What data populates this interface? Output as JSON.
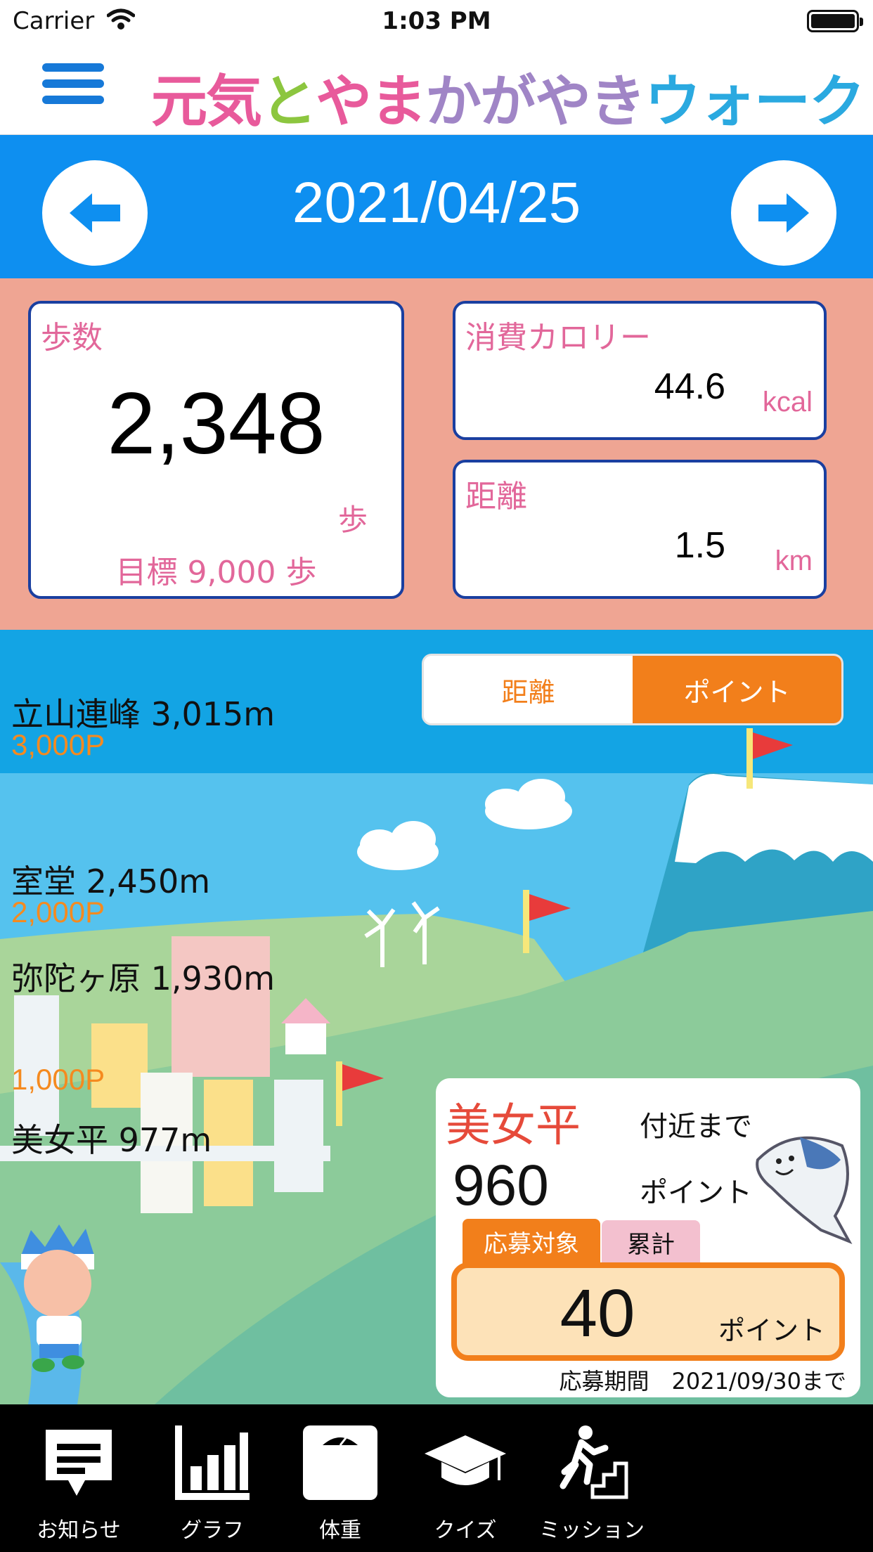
{
  "status_bar": {
    "carrier": "Carrier",
    "time": "1:03 PM"
  },
  "header": {
    "title_parts": [
      "元気",
      "と",
      "やま",
      "かがやき",
      "ウォーク"
    ],
    "colors": {
      "pink": "#e85a9b",
      "green": "#8cc63f",
      "purple": "#a085c6",
      "blue": "#2aa9e0"
    }
  },
  "date_nav": {
    "date": "2021/04/25",
    "prev_icon": "arrow-left-icon",
    "next_icon": "arrow-right-icon"
  },
  "stats": {
    "steps": {
      "label": "歩数",
      "value": "2,348",
      "unit": "歩",
      "goal": "目標 9,000 歩"
    },
    "calories": {
      "label": "消費カロリー",
      "value": "44.6",
      "unit": "kcal"
    },
    "distance": {
      "label": "距離",
      "value": "1.5",
      "unit": "km"
    }
  },
  "map": {
    "toggle": {
      "distance": "距離",
      "point": "ポイント",
      "selected": "ポイント"
    },
    "landmarks": [
      {
        "name": "立山連峰 3,015m",
        "points": "3,000P"
      },
      {
        "name": "室堂 2,450m",
        "points": "2,000P"
      },
      {
        "name": "弥陀ヶ原 1,930m",
        "points": ""
      },
      {
        "name": "美女平 977m",
        "points": "1,000P"
      }
    ]
  },
  "points_card": {
    "place": "美女平",
    "until": "付近まで",
    "remaining": "960",
    "remaining_unit": "ポイント",
    "tabs": {
      "apply": "応募対象",
      "total": "累計"
    },
    "value": "40",
    "value_unit": "ポイント",
    "period": "応募期間　2021/09/30まで"
  },
  "tab_bar": {
    "items": [
      {
        "label": "お知らせ",
        "icon": "notice-icon"
      },
      {
        "label": "グラフ",
        "icon": "graph-icon"
      },
      {
        "label": "体重",
        "icon": "scale-icon"
      },
      {
        "label": "クイズ",
        "icon": "graduation-cap-icon"
      },
      {
        "label": "ミッション",
        "icon": "stairs-runner-icon"
      }
    ]
  }
}
